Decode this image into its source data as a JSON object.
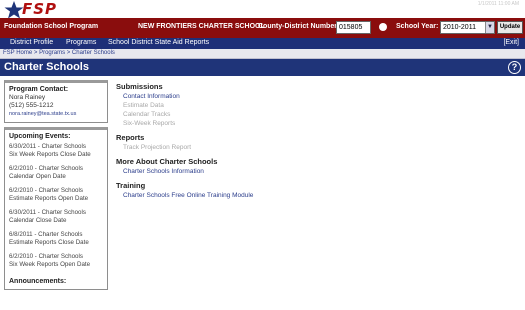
{
  "app": {
    "logo_text": "FSP",
    "corner_faint_text": "1/1/2011 11:00 AM"
  },
  "header": {
    "program_name": "Foundation School Program",
    "school_name": "NEW FRONTIERS CHARTER SCHOOL",
    "county_district_label": "County-District Number:",
    "county_district_value": "015805",
    "school_year_label": "School Year:",
    "school_year_value": "2010-2011",
    "update_button": "Update"
  },
  "nav": {
    "items": [
      "District Profile",
      "Programs",
      "School District State Aid Reports"
    ],
    "exit_label": "[Exit]"
  },
  "breadcrumb": "FSP Home > Programs > Charter Schools",
  "page_title": "Charter Schools",
  "sidebar": {
    "contact": {
      "heading": "Program Contact:",
      "name": "Nora Rainey",
      "phone": "(512) 555-1212",
      "email": "nora.rainey@tea.state.tx.us"
    },
    "events": {
      "heading": "Upcoming Events:",
      "items": [
        [
          "6/30/2011 - Charter Schools",
          "Six Week Reports Close Date"
        ],
        [
          "6/2/2010 - Charter Schools",
          "Calendar Open Date"
        ],
        [
          "6/2/2010 - Charter Schools",
          "Estimate Reports Open Date"
        ],
        [
          "6/30/2011 - Charter Schools",
          "Calendar Close Date"
        ],
        [
          "6/8/2011 - Charter Schools",
          "Estimate Reports Close Date"
        ],
        [
          "6/2/2010 - Charter Schools",
          "Six Week Reports Open Date"
        ]
      ],
      "announcements_heading": "Announcements:"
    }
  },
  "main": {
    "sections": [
      {
        "heading": "Submissions",
        "links": [
          {
            "label": "Contact Information",
            "enabled": true
          },
          {
            "label": "Estimate Data",
            "enabled": false
          },
          {
            "label": "Calendar Tracks",
            "enabled": false
          },
          {
            "label": "Six-Week Reports",
            "enabled": false
          }
        ]
      },
      {
        "heading": "Reports",
        "links": [
          {
            "label": "Track Projection Report",
            "enabled": false
          }
        ]
      },
      {
        "heading": "More About Charter Schools",
        "links": [
          {
            "label": "Charter Schools Information",
            "enabled": true
          }
        ]
      },
      {
        "heading": "Training",
        "links": [
          {
            "label": "Charter Schools Free Online Training Module",
            "enabled": true
          }
        ]
      }
    ]
  },
  "colors": {
    "header_red": "#8a0d0d",
    "nav_blue": "#1e2f78",
    "title_blue": "#1f3479",
    "link_blue": "#2b3d8b",
    "disabled_gray": "#a8a8a8"
  }
}
